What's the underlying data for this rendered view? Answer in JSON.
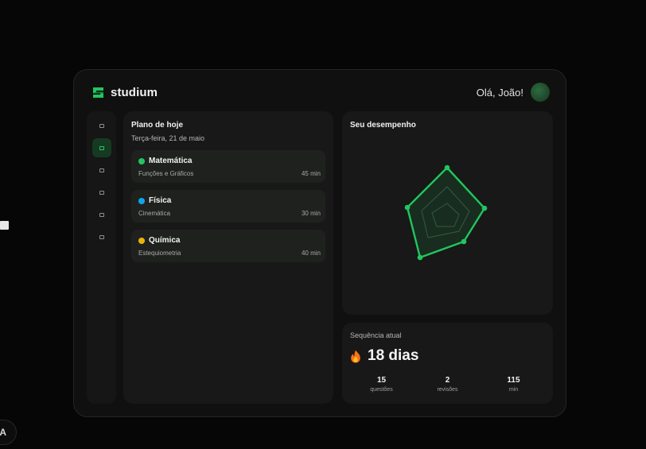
{
  "app": {
    "name": "studium"
  },
  "header": {
    "greeting": "Olá, João!"
  },
  "floating": {
    "avatar_initial": "A"
  },
  "sidebar": {
    "items": [
      {
        "id": "item-1",
        "active": false
      },
      {
        "id": "item-2",
        "active": true
      },
      {
        "id": "item-3",
        "active": false
      },
      {
        "id": "item-4",
        "active": false
      },
      {
        "id": "item-5",
        "active": false
      },
      {
        "id": "item-6",
        "active": false
      }
    ]
  },
  "plan": {
    "title": "Plano de hoje",
    "date": "Terça-feira, 21 de maio",
    "subjects": [
      {
        "name": "Matemática",
        "topic": "Funções e Gráficos",
        "minutes": "45 min",
        "color": "#22c55e"
      },
      {
        "name": "Física",
        "topic": "Cinemática",
        "minutes": "30 min",
        "color": "#0ea5e9"
      },
      {
        "name": "Química",
        "topic": "Estequiometria",
        "minutes": "40 min",
        "color": "#eab308"
      }
    ]
  },
  "performance": {
    "title": "Seu desempenho",
    "accent": "#22c55e"
  },
  "streak": {
    "label": "Sequência atual",
    "value": "18 dias",
    "stats": [
      {
        "value": "15",
        "label": "questões"
      },
      {
        "value": "2",
        "label": "revisões"
      },
      {
        "value": "115",
        "label": "min"
      }
    ]
  },
  "colors": {
    "accent": "#22c55e",
    "background": "#060606",
    "panel": "#171817"
  }
}
